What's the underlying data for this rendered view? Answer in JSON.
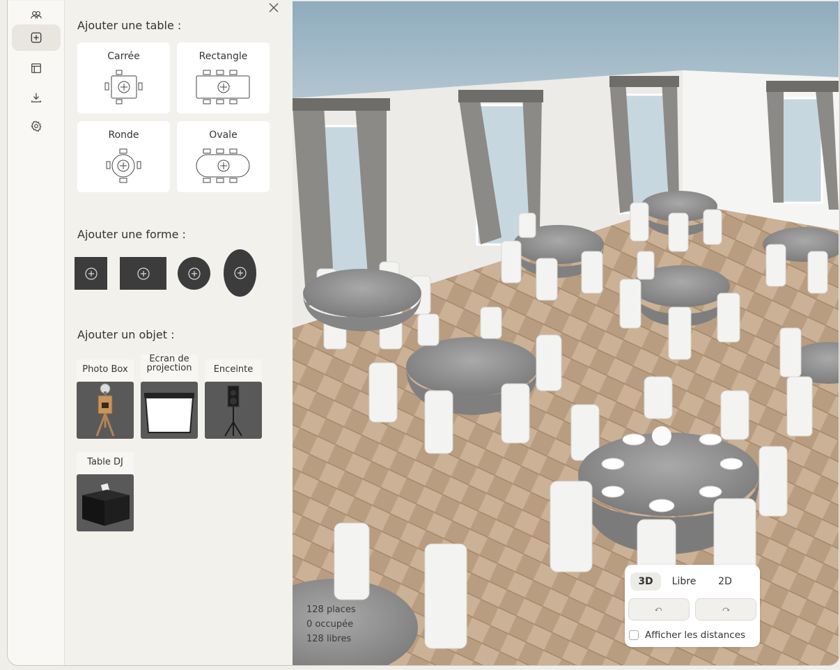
{
  "rail": {
    "items": [
      {
        "icon": "users-icon",
        "label": ""
      },
      {
        "icon": "add-square-icon",
        "label": ""
      },
      {
        "icon": "layout-icon",
        "label": ""
      },
      {
        "icon": "download-icon",
        "label": ""
      },
      {
        "icon": "gear-icon",
        "label": ""
      }
    ]
  },
  "panel": {
    "tables_title": "Ajouter une table :",
    "tables": [
      {
        "label": "Carrée"
      },
      {
        "label": "Rectangle"
      },
      {
        "label": "Ronde"
      },
      {
        "label": "Ovale"
      }
    ],
    "shapes_title": "Ajouter une forme :",
    "objects_title": "Ajouter un objet :",
    "objects": [
      {
        "label": "Photo Box"
      },
      {
        "label": "Ecran de projection"
      },
      {
        "label": "Enceinte"
      },
      {
        "label": "Table DJ"
      }
    ]
  },
  "stats": {
    "places": "128 places",
    "occupied": "0 occupée",
    "free": "128 libres"
  },
  "view": {
    "modes": [
      "3D",
      "Libre",
      "2D"
    ],
    "active_mode": "3D",
    "show_distances_label": "Afficher les distances"
  }
}
